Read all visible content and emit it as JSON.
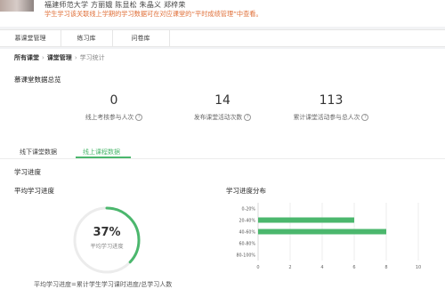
{
  "header": {
    "authors": "福建师范大学  方丽娥  陈显松  朱晶义  郑梓荣",
    "notice": "学生学习该关联线上学期的学习数据可在对应课堂的“平时成绩管理”中查看。"
  },
  "tabs": [
    {
      "label": "慕课堂管理"
    },
    {
      "label": "练习库"
    },
    {
      "label": "问卷库"
    }
  ],
  "breadcrumb": {
    "items": [
      "所有课堂",
      "课堂管理"
    ],
    "current": "学习统计"
  },
  "overview": {
    "title": "慕课堂数据总览",
    "stats": [
      {
        "value": "0",
        "label": "线上考核参与人次"
      },
      {
        "value": "14",
        "label": "发布课堂活动次数"
      },
      {
        "value": "113",
        "label": "累计课堂活动参与总人次"
      }
    ]
  },
  "subtabs": [
    {
      "label": "线下课堂数据",
      "active": false
    },
    {
      "label": "线上课程数据",
      "active": true
    }
  ],
  "progress": {
    "section_title": "学习进度",
    "avg_title": "平均学习进度",
    "percent_text": "37%",
    "percent_value": 0.37,
    "ring_caption": "平均学习进度",
    "formula": "平均学习进度=累计学生学习课时进度/总学习人数",
    "accent_color": "#4bb76d"
  },
  "chart_data": {
    "type": "bar",
    "orientation": "horizontal",
    "title": "学习进度分布",
    "categories": [
      "0-20%",
      "20-40%",
      "40-60%",
      "60-80%",
      "80-100%"
    ],
    "values": [
      0,
      6,
      8,
      0,
      0
    ],
    "xlim": [
      0,
      10
    ],
    "xticks": [
      0,
      2,
      4,
      6,
      8,
      10
    ],
    "grid": true,
    "color": "#4bb76d"
  }
}
